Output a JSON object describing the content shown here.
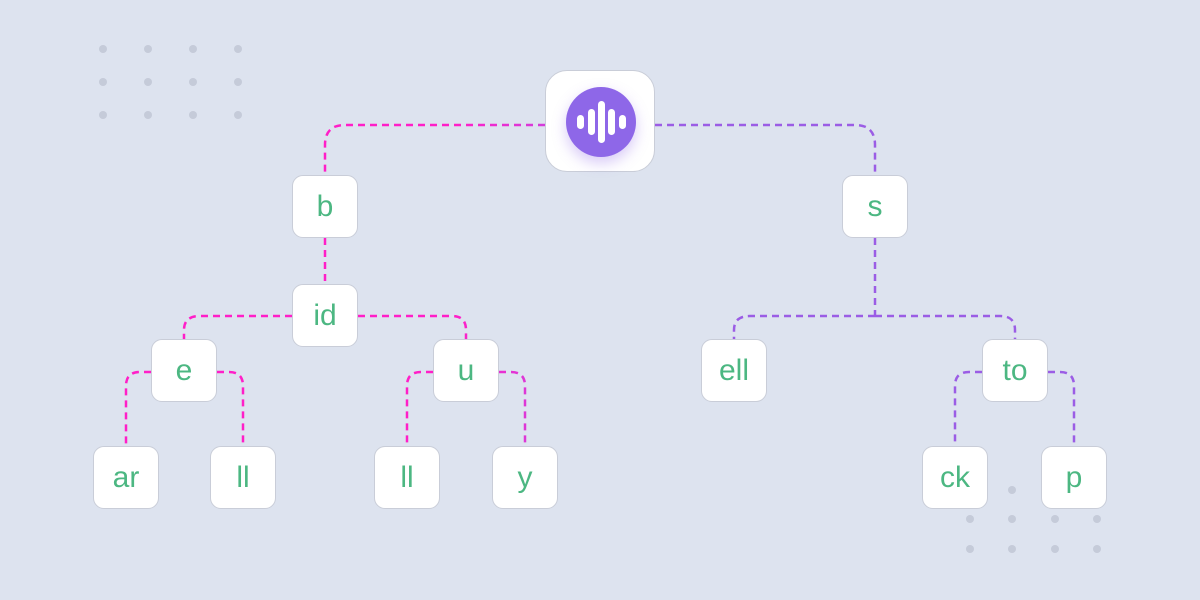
{
  "colors": {
    "background": "#dde3ef",
    "left_branch": "#ff1fc8",
    "right_branch": "#9b5de5",
    "text": "#4cb782",
    "logo": "#8e67e8"
  },
  "root": {
    "icon": "audio-waveform-icon"
  },
  "nodes": {
    "b": "b",
    "id": "id",
    "e": "e",
    "u": "u",
    "ar": "ar",
    "ll1": "ll",
    "ll2": "ll",
    "y": "y",
    "s": "s",
    "ell": "ell",
    "to": "to",
    "ck": "ck",
    "p": "p"
  }
}
